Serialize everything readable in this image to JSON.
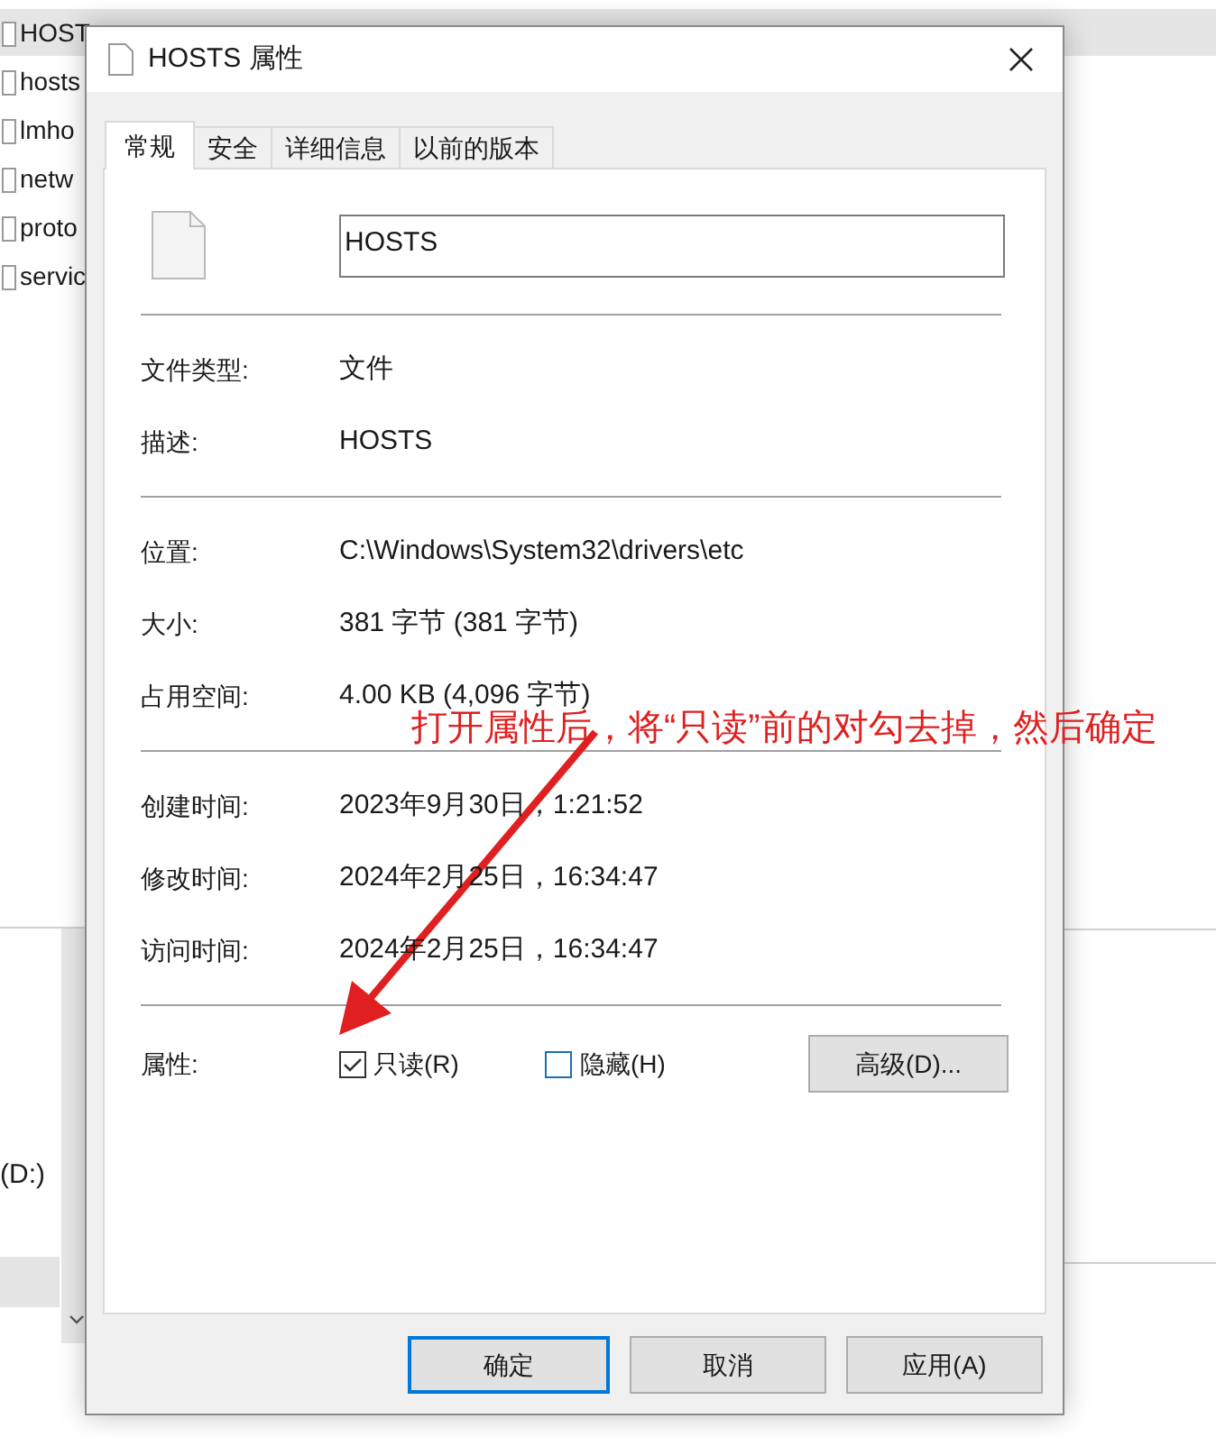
{
  "explorer": {
    "files": [
      {
        "name": "HOST",
        "selected": true
      },
      {
        "name": "hosts"
      },
      {
        "name": "lmho"
      },
      {
        "name": "netw"
      },
      {
        "name": "proto"
      },
      {
        "name": "servic"
      }
    ],
    "drive_label": "(D:)"
  },
  "dialog": {
    "title": "HOSTS 属性",
    "tabs": [
      {
        "label": "常规",
        "selected": true
      },
      {
        "label": "安全",
        "selected": false
      },
      {
        "label": "详细信息",
        "selected": false
      },
      {
        "label": "以前的版本",
        "selected": false
      }
    ],
    "file_name": "HOSTS",
    "sections": [
      [
        {
          "label": "文件类型:",
          "value": "文件"
        },
        {
          "label": "描述:",
          "value": "HOSTS"
        }
      ],
      [
        {
          "label": "位置:",
          "value": "C:\\Windows\\System32\\drivers\\etc"
        },
        {
          "label": "大小:",
          "value": "381 字节 (381 字节)"
        },
        {
          "label": "占用空间:",
          "value": "4.00 KB (4,096 字节)"
        }
      ],
      [
        {
          "label": "创建时间:",
          "value": "2023年9月30日，1:21:52"
        },
        {
          "label": "修改时间:",
          "value": "2024年2月25日，16:34:47"
        },
        {
          "label": "访问时间:",
          "value": "2024年2月25日，16:34:47"
        }
      ]
    ],
    "attributes": {
      "label": "属性:",
      "options": [
        {
          "label": "只读(R)",
          "checked": true
        },
        {
          "label": "隐藏(H)",
          "checked": false
        }
      ],
      "advanced_button": "高级(D)..."
    },
    "buttons": [
      {
        "label": "确定",
        "default": true
      },
      {
        "label": "取消",
        "default": false
      },
      {
        "label": "应用(A)",
        "default": false
      }
    ]
  },
  "annotation": "打开属性后，将“只读”前的对勾去掉，然后确定"
}
